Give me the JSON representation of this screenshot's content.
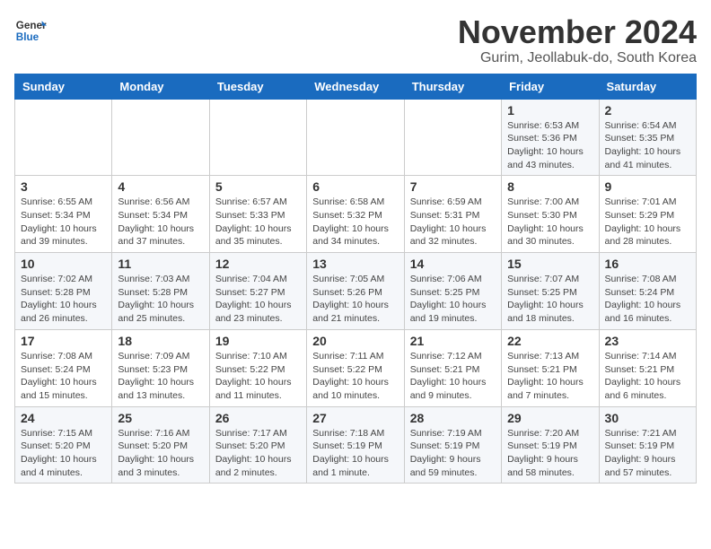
{
  "logo": {
    "general": "General",
    "blue": "Blue"
  },
  "title": "November 2024",
  "subtitle": "Gurim, Jeollabuk-do, South Korea",
  "weekdays": [
    "Sunday",
    "Monday",
    "Tuesday",
    "Wednesday",
    "Thursday",
    "Friday",
    "Saturday"
  ],
  "weeks": [
    [
      {
        "day": "",
        "info": ""
      },
      {
        "day": "",
        "info": ""
      },
      {
        "day": "",
        "info": ""
      },
      {
        "day": "",
        "info": ""
      },
      {
        "day": "",
        "info": ""
      },
      {
        "day": "1",
        "info": "Sunrise: 6:53 AM\nSunset: 5:36 PM\nDaylight: 10 hours and 43 minutes."
      },
      {
        "day": "2",
        "info": "Sunrise: 6:54 AM\nSunset: 5:35 PM\nDaylight: 10 hours and 41 minutes."
      }
    ],
    [
      {
        "day": "3",
        "info": "Sunrise: 6:55 AM\nSunset: 5:34 PM\nDaylight: 10 hours and 39 minutes."
      },
      {
        "day": "4",
        "info": "Sunrise: 6:56 AM\nSunset: 5:34 PM\nDaylight: 10 hours and 37 minutes."
      },
      {
        "day": "5",
        "info": "Sunrise: 6:57 AM\nSunset: 5:33 PM\nDaylight: 10 hours and 35 minutes."
      },
      {
        "day": "6",
        "info": "Sunrise: 6:58 AM\nSunset: 5:32 PM\nDaylight: 10 hours and 34 minutes."
      },
      {
        "day": "7",
        "info": "Sunrise: 6:59 AM\nSunset: 5:31 PM\nDaylight: 10 hours and 32 minutes."
      },
      {
        "day": "8",
        "info": "Sunrise: 7:00 AM\nSunset: 5:30 PM\nDaylight: 10 hours and 30 minutes."
      },
      {
        "day": "9",
        "info": "Sunrise: 7:01 AM\nSunset: 5:29 PM\nDaylight: 10 hours and 28 minutes."
      }
    ],
    [
      {
        "day": "10",
        "info": "Sunrise: 7:02 AM\nSunset: 5:28 PM\nDaylight: 10 hours and 26 minutes."
      },
      {
        "day": "11",
        "info": "Sunrise: 7:03 AM\nSunset: 5:28 PM\nDaylight: 10 hours and 25 minutes."
      },
      {
        "day": "12",
        "info": "Sunrise: 7:04 AM\nSunset: 5:27 PM\nDaylight: 10 hours and 23 minutes."
      },
      {
        "day": "13",
        "info": "Sunrise: 7:05 AM\nSunset: 5:26 PM\nDaylight: 10 hours and 21 minutes."
      },
      {
        "day": "14",
        "info": "Sunrise: 7:06 AM\nSunset: 5:25 PM\nDaylight: 10 hours and 19 minutes."
      },
      {
        "day": "15",
        "info": "Sunrise: 7:07 AM\nSunset: 5:25 PM\nDaylight: 10 hours and 18 minutes."
      },
      {
        "day": "16",
        "info": "Sunrise: 7:08 AM\nSunset: 5:24 PM\nDaylight: 10 hours and 16 minutes."
      }
    ],
    [
      {
        "day": "17",
        "info": "Sunrise: 7:08 AM\nSunset: 5:24 PM\nDaylight: 10 hours and 15 minutes."
      },
      {
        "day": "18",
        "info": "Sunrise: 7:09 AM\nSunset: 5:23 PM\nDaylight: 10 hours and 13 minutes."
      },
      {
        "day": "19",
        "info": "Sunrise: 7:10 AM\nSunset: 5:22 PM\nDaylight: 10 hours and 11 minutes."
      },
      {
        "day": "20",
        "info": "Sunrise: 7:11 AM\nSunset: 5:22 PM\nDaylight: 10 hours and 10 minutes."
      },
      {
        "day": "21",
        "info": "Sunrise: 7:12 AM\nSunset: 5:21 PM\nDaylight: 10 hours and 9 minutes."
      },
      {
        "day": "22",
        "info": "Sunrise: 7:13 AM\nSunset: 5:21 PM\nDaylight: 10 hours and 7 minutes."
      },
      {
        "day": "23",
        "info": "Sunrise: 7:14 AM\nSunset: 5:21 PM\nDaylight: 10 hours and 6 minutes."
      }
    ],
    [
      {
        "day": "24",
        "info": "Sunrise: 7:15 AM\nSunset: 5:20 PM\nDaylight: 10 hours and 4 minutes."
      },
      {
        "day": "25",
        "info": "Sunrise: 7:16 AM\nSunset: 5:20 PM\nDaylight: 10 hours and 3 minutes."
      },
      {
        "day": "26",
        "info": "Sunrise: 7:17 AM\nSunset: 5:20 PM\nDaylight: 10 hours and 2 minutes."
      },
      {
        "day": "27",
        "info": "Sunrise: 7:18 AM\nSunset: 5:19 PM\nDaylight: 10 hours and 1 minute."
      },
      {
        "day": "28",
        "info": "Sunrise: 7:19 AM\nSunset: 5:19 PM\nDaylight: 9 hours and 59 minutes."
      },
      {
        "day": "29",
        "info": "Sunrise: 7:20 AM\nSunset: 5:19 PM\nDaylight: 9 hours and 58 minutes."
      },
      {
        "day": "30",
        "info": "Sunrise: 7:21 AM\nSunset: 5:19 PM\nDaylight: 9 hours and 57 minutes."
      }
    ]
  ]
}
